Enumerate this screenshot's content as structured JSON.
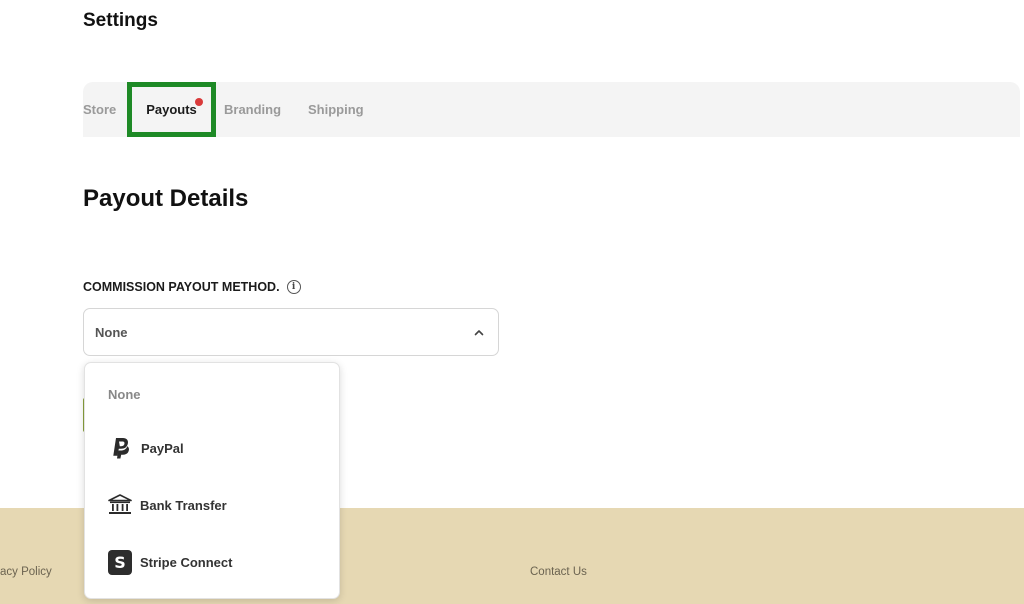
{
  "page": {
    "title": "Settings"
  },
  "tabs": [
    {
      "label": "Store",
      "active": false
    },
    {
      "label": "Payouts",
      "active": true,
      "notification": true
    },
    {
      "label": "Branding",
      "active": false
    },
    {
      "label": "Shipping",
      "active": false
    }
  ],
  "section": {
    "title": "Payout Details"
  },
  "commission": {
    "label": "COMMISSION PAYOUT METHOD.",
    "info_icon": "info-icon",
    "selected_value": "None",
    "dropdown_open": true,
    "options": [
      {
        "label": "None",
        "icon": ""
      },
      {
        "label": "PayPal",
        "icon": "paypal-icon"
      },
      {
        "label": "Bank Transfer",
        "icon": "bank-icon"
      },
      {
        "label": "Stripe Connect",
        "icon": "stripe-icon",
        "glyph": "S"
      }
    ]
  },
  "footer": {
    "privacy_label": "acy Policy",
    "contact_label": "Contact Us"
  },
  "colors": {
    "active_tab_outline": "#1e8a26",
    "notification_dot": "#d93a3a",
    "footer_bg": "#e6d8b3",
    "tab_bar_bg": "#f4f4f4"
  }
}
